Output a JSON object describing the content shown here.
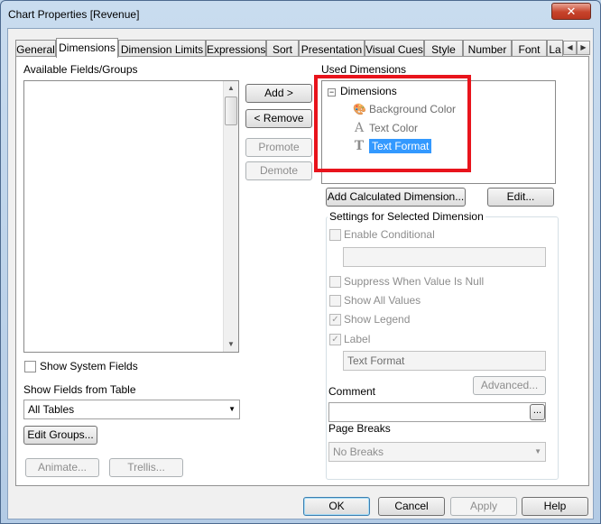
{
  "window": {
    "title": "Chart Properties [Revenue]",
    "close_glyph": "✕"
  },
  "tabs": [
    {
      "label": "General"
    },
    {
      "label": "Dimensions"
    },
    {
      "label": "Dimension Limits"
    },
    {
      "label": "Expressions"
    },
    {
      "label": "Sort"
    },
    {
      "label": "Presentation"
    },
    {
      "label": "Visual Cues"
    },
    {
      "label": "Style"
    },
    {
      "label": "Number"
    },
    {
      "label": "Font"
    },
    {
      "label": "La"
    }
  ],
  "tab_scroll": {
    "left": "◀",
    "right": "▶"
  },
  "available": {
    "label": "Available Fields/Groups",
    "show_system_fields": "Show System Fields",
    "show_fields_from_table_label": "Show Fields from Table",
    "table_selected": "All Tables",
    "edit_groups": "Edit Groups...",
    "animate": "Animate...",
    "trellis": "Trellis..."
  },
  "middle_buttons": {
    "add": "Add >",
    "remove": "< Remove",
    "promote": "Promote",
    "demote": "Demote"
  },
  "used": {
    "label": "Used Dimensions",
    "tree_root": "Dimensions",
    "expander": "−",
    "children": [
      {
        "label": "Background Color",
        "icon": "🎨"
      },
      {
        "label": "Text Color",
        "icon": "A"
      },
      {
        "label": "Text Format",
        "icon": "T"
      }
    ],
    "add_calculated": "Add Calculated Dimension...",
    "edit": "Edit..."
  },
  "settings": {
    "title": "Settings for Selected Dimension",
    "enable_conditional": "Enable Conditional",
    "suppress_null": "Suppress When Value Is Null",
    "show_all_values": "Show All Values",
    "show_legend": "Show Legend",
    "label": "Label",
    "label_value": "Text Format",
    "advanced": "Advanced...",
    "comment": "Comment",
    "comment_button": "...",
    "page_breaks": "Page Breaks",
    "page_breaks_value": "No Breaks",
    "check_glyph": "✓"
  },
  "footer": {
    "ok": "OK",
    "cancel": "Cancel",
    "apply": "Apply",
    "help": "Help"
  }
}
